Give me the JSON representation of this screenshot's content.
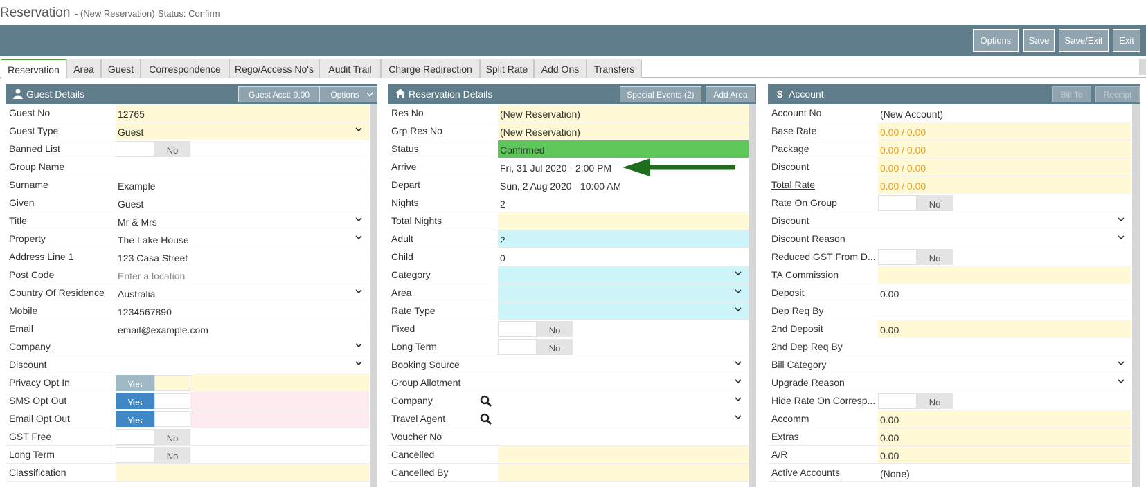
{
  "title": {
    "main": "Reservation",
    "sub": "- (New Reservation)",
    "status": "Status: Confirm"
  },
  "toolbar": {
    "options": "Options",
    "save": "Save",
    "save_exit": "Save/Exit",
    "exit": "Exit"
  },
  "tabs": [
    "Reservation",
    "Area",
    "Guest",
    "Correspondence",
    "Rego/Access No's",
    "Audit Trail",
    "Charge Redirection",
    "Split Rate",
    "Add Ons",
    "Transfers"
  ],
  "guest": {
    "title": "Guest Details",
    "acct_button": "Guest Acct: 0.00",
    "options_button": "Options",
    "icon": "user-icon",
    "rows": [
      {
        "label": "Guest No",
        "value": "12765"
      },
      {
        "label": "Guest Type",
        "value": "Guest"
      },
      {
        "label": "Banned List",
        "value": "No"
      },
      {
        "label": "Group Name",
        "value": ""
      },
      {
        "label": "Surname",
        "value": "Example"
      },
      {
        "label": "Given",
        "value": "Guest"
      },
      {
        "label": "Title",
        "value": "Mr & Mrs"
      },
      {
        "label": "Property",
        "value": "The Lake House"
      },
      {
        "label": "Address Line 1",
        "value": "123 Casa Street"
      },
      {
        "label": "Post Code",
        "value": "Enter a location"
      },
      {
        "label": "Country Of Residence",
        "value": "Australia"
      },
      {
        "label": "Mobile",
        "value": "1234567890"
      },
      {
        "label": "Email",
        "value": "email@example.com"
      },
      {
        "label": "Company",
        "value": ""
      },
      {
        "label": "Discount",
        "value": ""
      },
      {
        "label": "Privacy Opt In",
        "value": "Yes"
      },
      {
        "label": "SMS Opt Out",
        "value": "Yes"
      },
      {
        "label": "Email Opt Out",
        "value": "Yes"
      },
      {
        "label": "GST Free",
        "value": "No"
      },
      {
        "label": "Long Term",
        "value": "No"
      },
      {
        "label": "Classification",
        "value": ""
      }
    ]
  },
  "reservation": {
    "title": "Reservation Details",
    "special_events": "Special Events (2)",
    "add_area": "Add Area",
    "icon": "home-icon",
    "rows": [
      {
        "label": "Res No",
        "value": "(New Reservation)"
      },
      {
        "label": "Grp Res No",
        "value": "(New Reservation)"
      },
      {
        "label": "Status",
        "value": "Confirmed"
      },
      {
        "label": "Arrive",
        "value": "Fri, 31 Jul 2020 - 2:00 PM"
      },
      {
        "label": "Depart",
        "value": "Sun, 2 Aug 2020 - 10:00 AM"
      },
      {
        "label": "Nights",
        "value": "2"
      },
      {
        "label": "Total Nights",
        "value": ""
      },
      {
        "label": "Adult",
        "value": "2"
      },
      {
        "label": "Child",
        "value": "0"
      },
      {
        "label": "Category",
        "value": ""
      },
      {
        "label": "Area",
        "value": ""
      },
      {
        "label": "Rate Type",
        "value": ""
      },
      {
        "label": "Fixed",
        "value": "No"
      },
      {
        "label": "Long Term",
        "value": "No"
      },
      {
        "label": "Booking Source",
        "value": ""
      },
      {
        "label": "Group Allotment",
        "value": ""
      },
      {
        "label": "Company",
        "value": ""
      },
      {
        "label": "Travel Agent",
        "value": ""
      },
      {
        "label": "Voucher No",
        "value": ""
      },
      {
        "label": "Cancelled",
        "value": ""
      },
      {
        "label": "Cancelled By",
        "value": ""
      }
    ]
  },
  "account": {
    "title": "Account",
    "bill_to": "Bill To",
    "receipt": "Receipt",
    "icon": "dollar-icon",
    "rows": [
      {
        "label": "Account No",
        "value": "(New Account)"
      },
      {
        "label": "Base Rate",
        "value": "0.00 / 0.00"
      },
      {
        "label": "Package",
        "value": "0.00 / 0.00"
      },
      {
        "label": "Discount",
        "value": "0.00 / 0.00"
      },
      {
        "label": "Total Rate",
        "value": "0.00 / 0.00"
      },
      {
        "label": "Rate On Group",
        "value": "No"
      },
      {
        "label": "Discount",
        "value": ""
      },
      {
        "label": "Discount Reason",
        "value": ""
      },
      {
        "label": "Reduced GST From D...",
        "value": "No"
      },
      {
        "label": "TA Commission",
        "value": ""
      },
      {
        "label": "Deposit",
        "value": "0.00"
      },
      {
        "label": "Dep Req By",
        "value": ""
      },
      {
        "label": "2nd Deposit",
        "value": "0.00"
      },
      {
        "label": "2nd Dep Req By",
        "value": ""
      },
      {
        "label": "Bill Category",
        "value": ""
      },
      {
        "label": "Upgrade Reason",
        "value": ""
      },
      {
        "label": "Hide Rate On Corresp...",
        "value": "No"
      },
      {
        "label": "Accomm",
        "value": "0.00"
      },
      {
        "label": "Extras",
        "value": "0.00"
      },
      {
        "label": "A/R",
        "value": "0.00"
      },
      {
        "label": "Active Accounts",
        "value": "(None)"
      }
    ]
  },
  "colors": {
    "header": "#607d8b",
    "confirmed": "#5dc75a",
    "arrow": "#1e6e1e",
    "rate": "#f39c12",
    "toggle_on": "#3f88c5",
    "toggle_grey": "#9fbac4"
  }
}
